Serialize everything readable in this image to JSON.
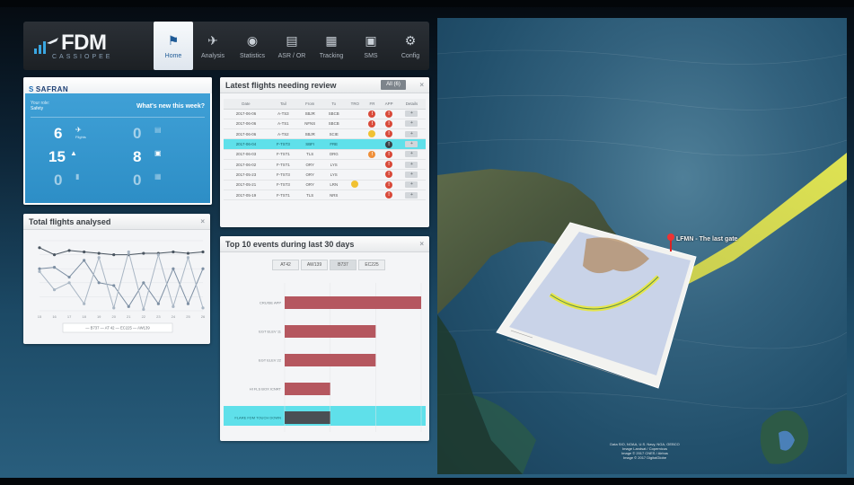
{
  "app": {
    "logo_text": "FDM",
    "logo_sub": "CASSIOPEE",
    "nav": [
      {
        "label": "Home",
        "icon": "home-icon",
        "active": true
      },
      {
        "label": "Analysis",
        "icon": "plane-icon",
        "active": false
      },
      {
        "label": "Statistics",
        "icon": "chart-icon",
        "active": false
      },
      {
        "label": "ASR / OR",
        "icon": "document-icon",
        "active": false
      },
      {
        "label": "Tracking",
        "icon": "calendar-icon",
        "active": false
      },
      {
        "label": "SMS",
        "icon": "clipboard-icon",
        "active": false
      },
      {
        "label": "Config",
        "icon": "gears-icon",
        "active": false
      }
    ]
  },
  "safran": {
    "brand": "SAFRAN",
    "role_label": "Your role:",
    "role": "Safety",
    "whats_new": "What's new this week?",
    "stats": [
      {
        "value": "6",
        "icon": "plane-icon",
        "label": "Flights",
        "dim": false
      },
      {
        "value": "0",
        "icon": "document-icon",
        "label": "",
        "dim": true
      },
      {
        "value": "15",
        "icon": "warning-icon",
        "label": "",
        "dim": false
      },
      {
        "value": "8",
        "icon": "clipboard-icon",
        "label": "",
        "dim": false
      },
      {
        "value": "0",
        "icon": "bookmark-icon",
        "label": "",
        "dim": true
      },
      {
        "value": "0",
        "icon": "calendar-icon",
        "label": "",
        "dim": true
      }
    ]
  },
  "total_flights": {
    "title": "Total flights analysed",
    "close": "×"
  },
  "latest": {
    "title": "Latest flights needing review",
    "all_button": "All (6)",
    "close": "×",
    "columns": [
      "Date",
      "Tail",
      "From",
      "To",
      "TRO",
      "FR",
      "APP",
      "Details"
    ],
    "rows": [
      {
        "date": "2017-06-06",
        "tail": "A-TS3",
        "from": "SBJR",
        "to": "SBCB",
        "tro": "",
        "fr": "!",
        "fr_color": "red",
        "app": "!",
        "app_color": "red",
        "details": "+",
        "highlight": false
      },
      {
        "date": "2017-06-06",
        "tail": "A-TS1",
        "from": "NFNS",
        "to": "SBCB",
        "tro": "",
        "fr": "!",
        "fr_color": "red",
        "app": "!",
        "app_color": "red",
        "details": "+",
        "highlight": false
      },
      {
        "date": "2017-06-06",
        "tail": "A-TS2",
        "from": "SBJR",
        "to": "SCIE",
        "tro": "",
        "fr": "",
        "fr_color": "yellow",
        "app": "!",
        "app_color": "red",
        "details": "+",
        "highlight": false
      },
      {
        "date": "2017-06-04",
        "tail": "F-TST3",
        "from": "SBFI",
        "to": "FRE",
        "tro": "",
        "fr": "",
        "fr_color": "",
        "app": "!",
        "app_color": "dark",
        "details": "+",
        "highlight": true
      },
      {
        "date": "2017-06-03",
        "tail": "F-TST1",
        "from": "TLS",
        "to": "ORG",
        "tro": "",
        "fr": "!",
        "fr_color": "orange",
        "app": "!",
        "app_color": "red",
        "details": "+",
        "highlight": false
      },
      {
        "date": "2017-06-02",
        "tail": "F-TST1",
        "from": "ORY",
        "to": "LYS",
        "tro": "",
        "fr": "",
        "fr_color": "",
        "app": "!",
        "app_color": "red",
        "details": "+",
        "highlight": false
      },
      {
        "date": "2017-05-23",
        "tail": "F-TST3",
        "from": "ORY",
        "to": "LYS",
        "tro": "",
        "fr": "",
        "fr_color": "",
        "app": "!",
        "app_color": "red",
        "details": "+",
        "highlight": false
      },
      {
        "date": "2017-05-21",
        "tail": "F-TST3",
        "from": "ORY",
        "to": "LRN",
        "tro": "",
        "tro_color": "yellow",
        "fr": "",
        "fr_color": "",
        "app": "!",
        "app_color": "red",
        "details": "+",
        "highlight": false
      },
      {
        "date": "2017-05-19",
        "tail": "F-TST1",
        "from": "TLS",
        "to": "NRS",
        "tro": "",
        "fr": "",
        "fr_color": "",
        "app": "!",
        "app_color": "red",
        "details": "+",
        "highlight": false
      }
    ]
  },
  "top10": {
    "title": "Top 10 events during last 30 days",
    "close": "×",
    "tabs": [
      "AT42",
      "AW139",
      "B737",
      "EC225"
    ],
    "active_tab": "B737"
  },
  "chart_data": [
    {
      "type": "line",
      "title": "Total flights analysed",
      "x": [
        "15",
        "16",
        "17",
        "18",
        "19",
        "20",
        "21",
        "22",
        "23",
        "24",
        "25",
        "26"
      ],
      "series": [
        {
          "name": "B737",
          "color": "#4a5560",
          "values": [
            45,
            40,
            43,
            42,
            41,
            40,
            40,
            41,
            41,
            42,
            41,
            42
          ]
        },
        {
          "name": "EC225",
          "color": "#7d8fa3",
          "values": [
            30,
            31,
            24,
            36,
            20,
            18,
            3,
            20,
            5,
            30,
            5,
            30
          ]
        },
        {
          "name": "AW139",
          "color": "#a9b6c4",
          "values": [
            28,
            15,
            20,
            5,
            38,
            2,
            42,
            1,
            40,
            3,
            38,
            2
          ]
        }
      ],
      "legend": [
        "B737",
        "AT 42",
        "EC225",
        "AW139"
      ],
      "legend_position": "bottom"
    },
    {
      "type": "bar",
      "orientation": "horizontal",
      "title": "Top 10 events during last 30 days",
      "categories": [
        "CRUISE APP",
        "EGT ELEV 11",
        "EGT ELEV 22",
        "HI FLS BOX ICNRT",
        "FLARE FDM TOUCH DOWN"
      ],
      "values": [
        3,
        2,
        2,
        1,
        1
      ],
      "highlight_index": 4,
      "bar_color": "#b5575f",
      "highlight_bar_color": "#4a4f54",
      "highlight_row_color": "#5fe0ea",
      "xlim": [
        0,
        3
      ],
      "x_ticks": [
        "0",
        "1",
        "2",
        "3"
      ]
    }
  ],
  "map": {
    "callout": "LFMN - The last gate",
    "credits_line1": "Data SIO, NOAA, U.S. Navy, NGA, GEBCO",
    "credits_line2": "Image Landsat / Copernicus",
    "credits_line3": "Image © 2017 CNES / Airbus",
    "credits_line4": "Image © 2017 DigitalGlobe"
  },
  "colors": {
    "nav_bg": "#1c2024",
    "safran_blue": "#2d8ec6",
    "bar": "#b5575f",
    "highlight": "#5fe0ea",
    "flight_path": "#e8e84a"
  }
}
